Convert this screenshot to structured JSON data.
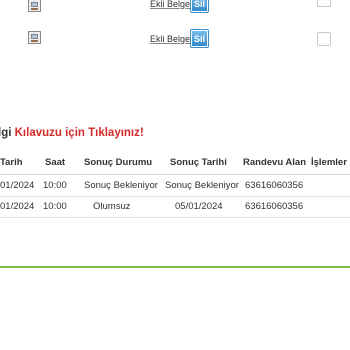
{
  "attachments": {
    "rows": [
      {
        "link_text": "Ekli Belge",
        "delete_label": "Sil"
      },
      {
        "link_text": "Ekli Belge",
        "delete_label": "Sil"
      }
    ]
  },
  "guide": {
    "text_prefix": "lgi ",
    "text_highlight": "Kılavuzu için Tıklayınız!"
  },
  "table": {
    "headers": [
      "Tarih",
      "Saat",
      "Sonuç Durumu",
      "Sonuç Tarihi",
      "Randevu Alan",
      "İşlemler"
    ],
    "rows": [
      {
        "tarih": "01/2024",
        "saat": "10:00",
        "durum": "Sonuç Bekleniyor",
        "sonuc_tarihi": "Sonuç Bekleniyor",
        "randevu_alan": "63616060356"
      },
      {
        "tarih": "01/2024",
        "saat": "10:00",
        "durum": "Olumsuz",
        "sonuc_tarihi": "05/01/2024",
        "randevu_alan": "63616060356"
      }
    ]
  },
  "colors": {
    "accent_green": "#7fbf4d",
    "link_red": "#d42a2a",
    "button_blue": "#2f86c8"
  }
}
